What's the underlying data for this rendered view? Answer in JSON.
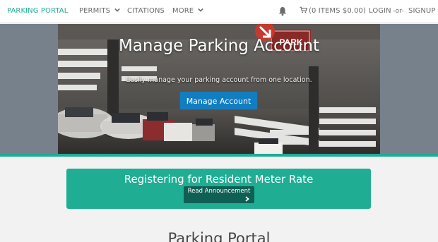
{
  "navbar": {
    "brand": "PARKING PORTAL",
    "permits": "PERMITS",
    "citations": "CITATIONS",
    "more": "MORE",
    "cart": "(0 ITEMS $0.00)",
    "login": "LOGIN",
    "or": "-or-",
    "signup": "SIGNUP"
  },
  "hero": {
    "title": "Manage Parking Account",
    "subtitle": "Easily manage your parking account from one location.",
    "button": "Manage Account",
    "sign_text": "PARK"
  },
  "announcement": {
    "title": "Registering for Resident Meter Rate",
    "button": "Read Announcement"
  },
  "page": {
    "heading": "Parking Portal"
  },
  "colors": {
    "brand": "#1fae93",
    "primary_button": "#127ec2",
    "announcement_bg": "#1fae93",
    "announcement_button": "#0f5f54"
  },
  "icons": {
    "permits_caret": "chevron-down-icon",
    "more_caret": "chevron-down-icon",
    "notifications": "bell-icon",
    "cart": "shopping-cart-icon",
    "announcement_arrow": "chevron-right-icon"
  }
}
